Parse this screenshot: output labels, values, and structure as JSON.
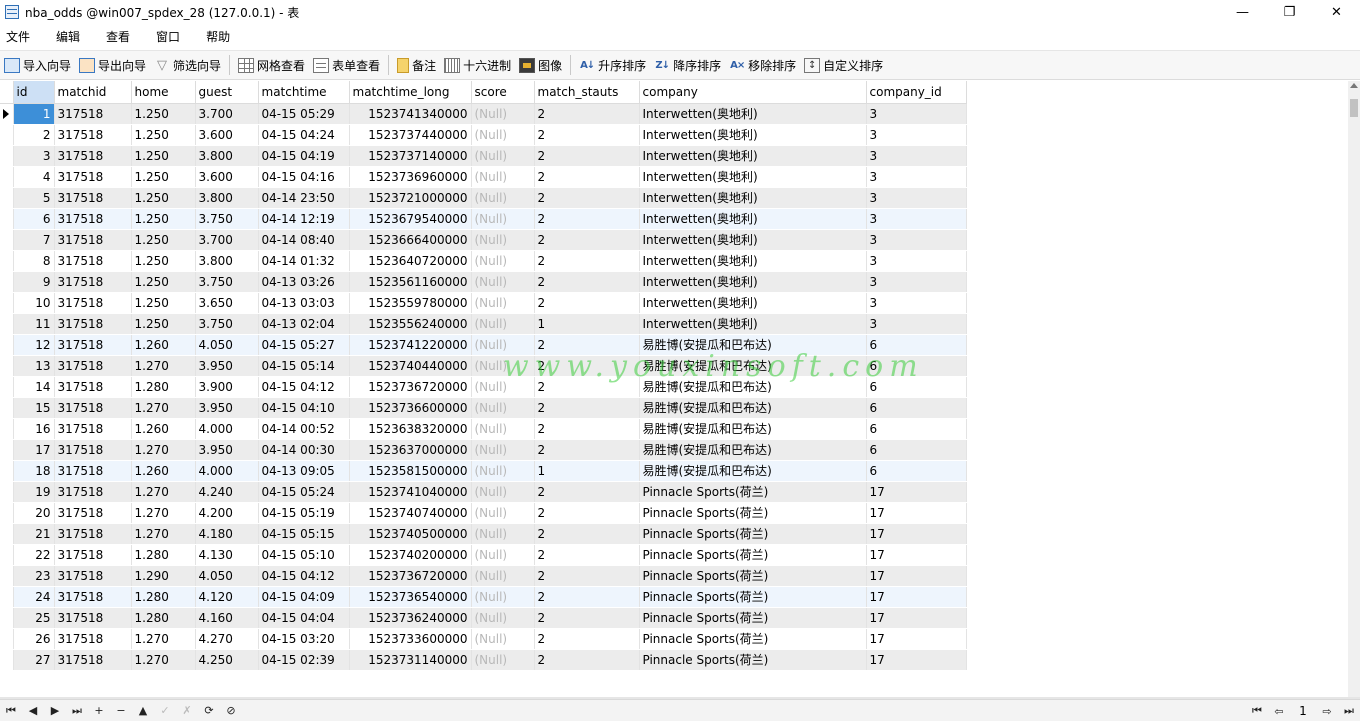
{
  "window": {
    "title": "nba_odds @win007_spdex_28 (127.0.0.1) - 表",
    "minimize": "—",
    "maximize": "❐",
    "close": "✕"
  },
  "menu": [
    "文件",
    "编辑",
    "查看",
    "窗口",
    "帮助"
  ],
  "toolbar": {
    "import_wizard": "导入向导",
    "export_wizard": "导出向导",
    "filter_wizard": "筛选向导",
    "grid_view": "网格查看",
    "form_view": "表单查看",
    "memo": "备注",
    "hex": "十六进制",
    "image": "图像",
    "sort_asc": "升序排序",
    "sort_desc": "降序排序",
    "remove_sort": "移除排序",
    "custom_sort": "自定义排序"
  },
  "grid": {
    "columns": [
      "id",
      "matchid",
      "home",
      "guest",
      "matchtime",
      "matchtime_long",
      "score",
      "match_stauts",
      "company",
      "company_id"
    ],
    "null_label": "(Null)",
    "rows": [
      [
        "1",
        "317518",
        "1.250",
        "3.700",
        "04-15 05:29",
        "1523741340000",
        "(Null)",
        "2",
        "Interwetten(奥地利)",
        "3"
      ],
      [
        "2",
        "317518",
        "1.250",
        "3.600",
        "04-15 04:24",
        "1523737440000",
        "(Null)",
        "2",
        "Interwetten(奥地利)",
        "3"
      ],
      [
        "3",
        "317518",
        "1.250",
        "3.800",
        "04-15 04:19",
        "1523737140000",
        "(Null)",
        "2",
        "Interwetten(奥地利)",
        "3"
      ],
      [
        "4",
        "317518",
        "1.250",
        "3.600",
        "04-15 04:16",
        "1523736960000",
        "(Null)",
        "2",
        "Interwetten(奥地利)",
        "3"
      ],
      [
        "5",
        "317518",
        "1.250",
        "3.800",
        "04-14 23:50",
        "1523721000000",
        "(Null)",
        "2",
        "Interwetten(奥地利)",
        "3"
      ],
      [
        "6",
        "317518",
        "1.250",
        "3.750",
        "04-14 12:19",
        "1523679540000",
        "(Null)",
        "2",
        "Interwetten(奥地利)",
        "3"
      ],
      [
        "7",
        "317518",
        "1.250",
        "3.700",
        "04-14 08:40",
        "1523666400000",
        "(Null)",
        "2",
        "Interwetten(奥地利)",
        "3"
      ],
      [
        "8",
        "317518",
        "1.250",
        "3.800",
        "04-14 01:32",
        "1523640720000",
        "(Null)",
        "2",
        "Interwetten(奥地利)",
        "3"
      ],
      [
        "9",
        "317518",
        "1.250",
        "3.750",
        "04-13 03:26",
        "1523561160000",
        "(Null)",
        "2",
        "Interwetten(奥地利)",
        "3"
      ],
      [
        "10",
        "317518",
        "1.250",
        "3.650",
        "04-13 03:03",
        "1523559780000",
        "(Null)",
        "2",
        "Interwetten(奥地利)",
        "3"
      ],
      [
        "11",
        "317518",
        "1.250",
        "3.750",
        "04-13 02:04",
        "1523556240000",
        "(Null)",
        "1",
        "Interwetten(奥地利)",
        "3"
      ],
      [
        "12",
        "317518",
        "1.260",
        "4.050",
        "04-15 05:27",
        "1523741220000",
        "(Null)",
        "2",
        "易胜博(安提瓜和巴布达)",
        "6"
      ],
      [
        "13",
        "317518",
        "1.270",
        "3.950",
        "04-15 05:14",
        "1523740440000",
        "(Null)",
        "2",
        "易胜博(安提瓜和巴布达)",
        "6"
      ],
      [
        "14",
        "317518",
        "1.280",
        "3.900",
        "04-15 04:12",
        "1523736720000",
        "(Null)",
        "2",
        "易胜博(安提瓜和巴布达)",
        "6"
      ],
      [
        "15",
        "317518",
        "1.270",
        "3.950",
        "04-15 04:10",
        "1523736600000",
        "(Null)",
        "2",
        "易胜博(安提瓜和巴布达)",
        "6"
      ],
      [
        "16",
        "317518",
        "1.260",
        "4.000",
        "04-14 00:52",
        "1523638320000",
        "(Null)",
        "2",
        "易胜博(安提瓜和巴布达)",
        "6"
      ],
      [
        "17",
        "317518",
        "1.270",
        "3.950",
        "04-14 00:30",
        "1523637000000",
        "(Null)",
        "2",
        "易胜博(安提瓜和巴布达)",
        "6"
      ],
      [
        "18",
        "317518",
        "1.260",
        "4.000",
        "04-13 09:05",
        "1523581500000",
        "(Null)",
        "1",
        "易胜博(安提瓜和巴布达)",
        "6"
      ],
      [
        "19",
        "317518",
        "1.270",
        "4.240",
        "04-15 05:24",
        "1523741040000",
        "(Null)",
        "2",
        "Pinnacle Sports(荷兰)",
        "17"
      ],
      [
        "20",
        "317518",
        "1.270",
        "4.200",
        "04-15 05:19",
        "1523740740000",
        "(Null)",
        "2",
        "Pinnacle Sports(荷兰)",
        "17"
      ],
      [
        "21",
        "317518",
        "1.270",
        "4.180",
        "04-15 05:15",
        "1523740500000",
        "(Null)",
        "2",
        "Pinnacle Sports(荷兰)",
        "17"
      ],
      [
        "22",
        "317518",
        "1.280",
        "4.130",
        "04-15 05:10",
        "1523740200000",
        "(Null)",
        "2",
        "Pinnacle Sports(荷兰)",
        "17"
      ],
      [
        "23",
        "317518",
        "1.290",
        "4.050",
        "04-15 04:12",
        "1523736720000",
        "(Null)",
        "2",
        "Pinnacle Sports(荷兰)",
        "17"
      ],
      [
        "24",
        "317518",
        "1.280",
        "4.120",
        "04-15 04:09",
        "1523736540000",
        "(Null)",
        "2",
        "Pinnacle Sports(荷兰)",
        "17"
      ],
      [
        "25",
        "317518",
        "1.280",
        "4.160",
        "04-15 04:04",
        "1523736240000",
        "(Null)",
        "2",
        "Pinnacle Sports(荷兰)",
        "17"
      ],
      [
        "26",
        "317518",
        "1.270",
        "4.270",
        "04-15 03:20",
        "1523733600000",
        "(Null)",
        "2",
        "Pinnacle Sports(荷兰)",
        "17"
      ],
      [
        "27",
        "317518",
        "1.270",
        "4.250",
        "04-15 02:39",
        "1523731140000",
        "(Null)",
        "2",
        "Pinnacle Sports(荷兰)",
        "17"
      ]
    ]
  },
  "watermark": "www.youxinsoft.com",
  "statusbar": {
    "first": "⏮",
    "prev": "◀",
    "next": "▶",
    "last": "⏭",
    "add": "+",
    "delete": "−",
    "up": "▲",
    "apply": "✓",
    "cancel": "✗",
    "refresh": "⟳",
    "stop": "⊘",
    "page_first": "⏮",
    "page_prev": "⇦",
    "page": "1",
    "page_next": "⇨",
    "page_last": "⏭"
  },
  "colors": {
    "selection": "#3d8fd8",
    "stripe": "#ececec",
    "hover_row": "#eef5fd",
    "null_text": "#b8b8b8",
    "watermark": "#3ccd3c"
  }
}
